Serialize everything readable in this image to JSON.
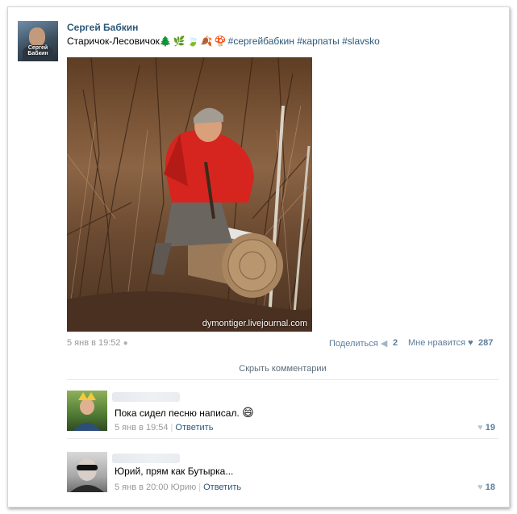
{
  "post": {
    "author": "Сергей Бабкин",
    "avatar_label": "Сергей Бабкин",
    "text": "Старичок-Лесовичок",
    "emojis": [
      "🌲",
      "🌿",
      "🍃",
      "🍂",
      "🍄"
    ],
    "hashtags": "#сергейбабкин #карпаты #slavsko",
    "photo_watermark": "dymontiger.livejournal.com",
    "date": "5 янв в 19:52",
    "share_label": "Поделиться",
    "share_count": "2",
    "like_label": "Мне нравится",
    "like_count": "287",
    "icons": {
      "share": "megaphone-icon",
      "like": "heart-icon",
      "device": "apple-icon"
    }
  },
  "hide_comments_label": "Скрыть комментарии",
  "comments": [
    {
      "text": "Пока сидел песню написал.",
      "emoji": "😄",
      "date": "5 янв в 19:54",
      "reply_label": "Ответить",
      "likes": "19"
    },
    {
      "text": "Юрий, прям как Бутырка...",
      "date": "5 янв в 20:00",
      "addressee": "Юрию",
      "reply_label": "Ответить",
      "likes": "18"
    }
  ],
  "colors": {
    "link": "#2b587a",
    "muted": "#999999",
    "action": "#5d7d9b"
  }
}
